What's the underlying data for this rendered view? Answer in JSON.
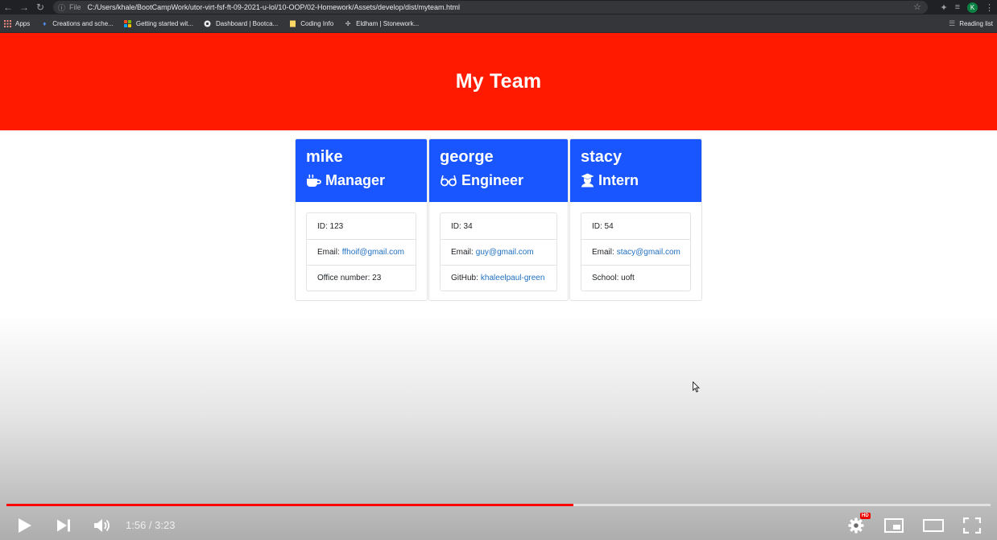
{
  "browser": {
    "file_label": "File",
    "url": "C:/Users/khale/BootCampWork/utor-virt-fsf-ft-09-2021-u-lol/10-OOP/02-Homework/Assets/develop/dist/myteam.html",
    "profile_initial": "K",
    "bookmarks": [
      {
        "label": "Apps",
        "icon": "apps-grid-icon"
      },
      {
        "label": "Creations and sche...",
        "icon": "bookmark-icon"
      },
      {
        "label": "Getting started wit...",
        "icon": "microsoft-icon"
      },
      {
        "label": "Dashboard | Bootca...",
        "icon": "globe-icon"
      },
      {
        "label": "Coding Info",
        "icon": "folder-icon"
      },
      {
        "label": "Eldham | Stonework...",
        "icon": "site-icon"
      }
    ],
    "reading_list": "Reading list"
  },
  "page": {
    "title": "My Team",
    "colors": {
      "header": "#ff1a00",
      "card_header": "#1a56ff",
      "link": "#1f6fc0"
    },
    "cards": [
      {
        "name": "mike",
        "role": "Manager",
        "role_icon": "coffee-mug-icon",
        "id_text": "ID: 123",
        "email_label": "Email:",
        "email": "ffhoif@gmail.com",
        "extra_text": "Office number: 23"
      },
      {
        "name": "george",
        "role": "Engineer",
        "role_icon": "glasses-icon",
        "id_text": "ID: 34",
        "email_label": "Email:",
        "email": "guy@gmail.com",
        "extra_label": "GitHub:",
        "extra_link": "khaleelpaul-green"
      },
      {
        "name": "stacy",
        "role": "Intern",
        "role_icon": "graduate-icon",
        "id_text": "ID: 54",
        "email_label": "Email:",
        "email": "stacy@gmail.com",
        "extra_text": "School: uoft"
      }
    ]
  },
  "video": {
    "time": "1:56 / 3:23",
    "progress_fraction": 0.576,
    "quality_badge": "HD"
  }
}
